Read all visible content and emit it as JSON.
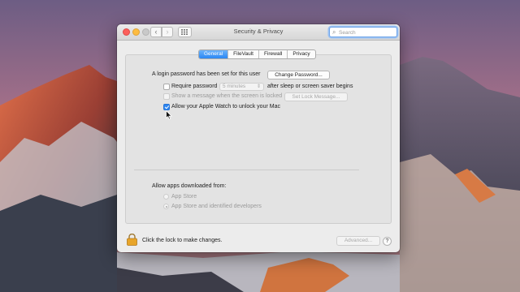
{
  "window": {
    "title": "Security & Privacy",
    "search_placeholder": "Search"
  },
  "icons": {
    "back": "chevron-left-icon",
    "forward": "chevron-right-icon",
    "show_all": "grid-icon",
    "search": "magnifier-icon",
    "lock": "lock-icon",
    "help": "question-mark-icon"
  },
  "tabs": [
    {
      "label": "General",
      "active": true
    },
    {
      "label": "FileVault",
      "active": false
    },
    {
      "label": "Firewall",
      "active": false
    },
    {
      "label": "Privacy",
      "active": false
    }
  ],
  "general": {
    "login_password_text": "A login password has been set for this user",
    "change_password_label": "Change Password...",
    "require_password_label": "Require password",
    "require_password_checked": false,
    "require_password_delay": "5 minutes",
    "require_password_suffix": "after sleep or screen saver begins",
    "show_message_label": "Show a message when the screen is locked",
    "show_message_checked": false,
    "set_lock_message_label": "Set Lock Message...",
    "apple_watch_label": "Allow your Apple Watch to unlock your Mac",
    "apple_watch_checked": true,
    "allow_apps_heading": "Allow apps downloaded from:",
    "radio_app_store": "App Store",
    "radio_identified": "App Store and identified developers",
    "selected_radio": "App Store and identified developers"
  },
  "footer": {
    "lock_text": "Click the lock to make changes.",
    "advanced_label": "Advanced...",
    "help_glyph": "?"
  },
  "colors": {
    "accent": "#2d86f1",
    "lock": "#e8a52a"
  }
}
